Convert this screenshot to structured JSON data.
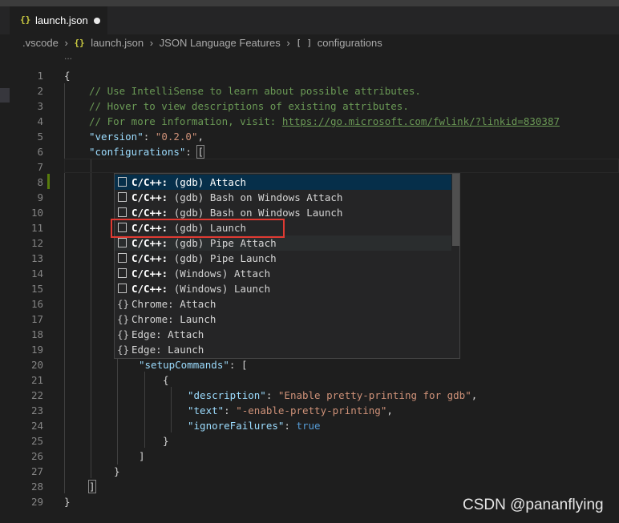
{
  "tab": {
    "icon": "{}",
    "title": "launch.json"
  },
  "breadcrumb": {
    "items": [
      ".vscode",
      "launch.json",
      "JSON Language Features",
      "configurations"
    ],
    "brace_icon": "{}",
    "array_icon": "[ ]"
  },
  "ellipsis": "...",
  "line_numbers": [
    "1",
    "2",
    "3",
    "4",
    "5",
    "6",
    "7",
    "8",
    "9",
    "10",
    "11",
    "12",
    "13",
    "14",
    "15",
    "16",
    "17",
    "18",
    "19",
    "20",
    "21",
    "22",
    "23",
    "24",
    "25",
    "26",
    "27",
    "28",
    "29"
  ],
  "code": {
    "l1": "{",
    "l2": "// Use IntelliSense to learn about possible attributes.",
    "l3": "// Hover to view descriptions of existing attributes.",
    "l4_prefix": "// For more information, visit: ",
    "l4_link": "https://go.microsoft.com/fwlink/?linkid=830387",
    "l5_key": "\"version\"",
    "l5_colon": ": ",
    "l5_val": "\"0.2.0\"",
    "l5_end": ",",
    "l6_key": "\"configurations\"",
    "l6_colon": ": ",
    "l6_bracket": "[",
    "l20_key": "\"setupCommands\"",
    "l20_rest": ": [",
    "l21": "{",
    "l22_key": "\"description\"",
    "l22_colon": ": ",
    "l22_val": "\"Enable pretty-printing for gdb\"",
    "l22_end": ",",
    "l23_key": "\"text\"",
    "l23_colon": ": ",
    "l23_val": "\"-enable-pretty-printing\"",
    "l23_end": ",",
    "l24_key": "\"ignoreFailures\"",
    "l24_colon": ": ",
    "l24_val": "true",
    "l25": "}",
    "l26": "]",
    "l27": "}",
    "l28": "]",
    "l29": "}"
  },
  "suggestions": [
    {
      "prefix": "C/C++: ",
      "rest": "(gdb) Attach",
      "icon": "snippet-icon"
    },
    {
      "prefix": "C/C++: ",
      "rest": "(gdb) Bash on Windows Attach",
      "icon": "snippet-icon"
    },
    {
      "prefix": "C/C++: ",
      "rest": "(gdb) Bash on Windows Launch",
      "icon": "snippet-icon"
    },
    {
      "prefix": "C/C++: ",
      "rest": "(gdb) Launch",
      "icon": "snippet-icon"
    },
    {
      "prefix": "C/C++: ",
      "rest": "(gdb) Pipe Attach",
      "icon": "snippet-icon"
    },
    {
      "prefix": "C/C++: ",
      "rest": "(gdb) Pipe Launch",
      "icon": "snippet-icon"
    },
    {
      "prefix": "C/C++: ",
      "rest": "(Windows) Attach",
      "icon": "snippet-icon"
    },
    {
      "prefix": "C/C++: ",
      "rest": "(Windows) Launch",
      "icon": "snippet-icon"
    },
    {
      "prefix": "Chrome: ",
      "rest": "Attach",
      "icon": "braces-icon"
    },
    {
      "prefix": "Chrome: ",
      "rest": "Launch",
      "icon": "braces-icon"
    },
    {
      "prefix": "Edge: ",
      "rest": "Attach",
      "icon": "braces-icon"
    },
    {
      "prefix": "Edge: ",
      "rest": "Launch",
      "icon": "braces-icon"
    }
  ],
  "braces_glyph": "{}",
  "watermark": "CSDN @pananflying",
  "colors": {
    "selection": "#062f4a",
    "highlight_box": "#e03a32",
    "comment": "#6a9955",
    "key": "#9cdcfe",
    "string": "#ce9178"
  }
}
